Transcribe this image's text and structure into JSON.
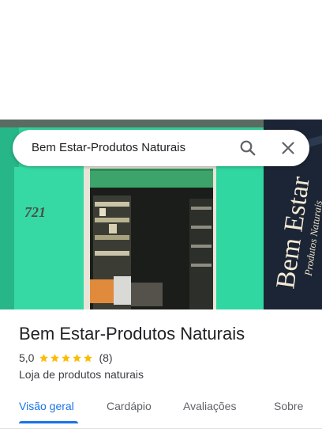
{
  "search": {
    "query": "Bem Estar-Produtos Naturais",
    "search_icon": "search-icon",
    "close_icon": "close-icon"
  },
  "photo": {
    "door_number": "721",
    "banner_text": "Bem Estar",
    "banner_subtext": "Produtos Naturais"
  },
  "place": {
    "title": "Bem Estar-Produtos Naturais",
    "rating": "5,0",
    "stars": 5,
    "reviews": "(8)",
    "category": "Loja de produtos naturais"
  },
  "tabs": [
    {
      "label": "Visão geral",
      "active": true
    },
    {
      "label": "Cardápio",
      "active": false
    },
    {
      "label": "Avaliações",
      "active": false
    },
    {
      "label": "Sobre",
      "active": false
    }
  ],
  "colors": {
    "accent": "#1a73e8",
    "star": "#fbbc04",
    "wall": "#2fd29b"
  }
}
